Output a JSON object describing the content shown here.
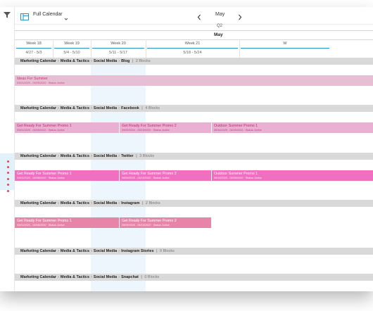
{
  "colors": {
    "accent": "#2b8fc9",
    "header_bg": "#d9d9d9",
    "event_light": "#e7bfd4",
    "event_mid": "#e9b0d3",
    "event_bright": "#ef70c1",
    "event_rose": "#e884a8",
    "status_dot": "#e4455b"
  },
  "toolbar": {
    "filter_icon": "filter-icon",
    "view_icon": "calendar-view-icon",
    "view_label": "Full Calendar",
    "prev_icon": "chevron-left-icon",
    "next_icon": "chevron-right-icon",
    "month": "May"
  },
  "timeline": {
    "quarter": "Q2",
    "month": "May",
    "weeks": [
      {
        "name": "Week 18",
        "range": "4/27 - 5/3"
      },
      {
        "name": "Week 19",
        "range": "5/4 - 5/10"
      },
      {
        "name": "Week 20",
        "range": "5/11 - 5/17"
      },
      {
        "name": "Week 21",
        "range": "5/18 - 5/24"
      },
      {
        "name": "W",
        "range": ""
      }
    ]
  },
  "breadcrumb_base": [
    "Marketing Calendar",
    "Media & Tactics",
    "Social Media"
  ],
  "sections": [
    {
      "channel": "Blog",
      "count": "2 Blocks",
      "events": [
        {
          "title": "Ideas For Summer",
          "meta": "03/01/2020 - 09/25/2020 · Status: Active",
          "style": "light"
        }
      ]
    },
    {
      "channel": "Facebook",
      "count": "4 Blocks",
      "events": [
        {
          "title": "Get Ready For Summer Promo 1",
          "meta": "03/01/2020 - 05/08/2020 · Status: Active",
          "style": "mid"
        },
        {
          "title": "Get Ready For Summer Promo 2",
          "meta": "05/09/2020 - 05/15/2020 · Status: Active",
          "style": "mid"
        },
        {
          "title": "Outdoor Summer Promo 1",
          "meta": "05/16/2020 - 06/30/2020 · Status: Active",
          "style": "mid"
        }
      ]
    },
    {
      "channel": "Twitter",
      "count": "3 Blocks",
      "events": [
        {
          "title": "Get Ready For Summer Promo 1",
          "meta": "03/01/2020 - 05/08/2020 · Status: Active",
          "style": "bright"
        },
        {
          "title": "Get Ready For Summer Promo 2",
          "meta": "05/09/2020 - 05/15/2020 · Status: Active",
          "style": "bright"
        },
        {
          "title": "Outdoor Summer Promo 1",
          "meta": "05/16/2020 - 06/30/2020 · Status: Active",
          "style": "bright"
        }
      ]
    },
    {
      "channel": "Instagram",
      "count": "2 Blocks",
      "events": [
        {
          "title": "Get Ready For Summer Promo 1",
          "meta": "03/01/2020 - 05/08/2020 · Status: Active",
          "style": "rose"
        },
        {
          "title": "Get Ready For Summer Promo 2",
          "meta": "05/09/2020 - 05/15/2020 · Status: Active",
          "style": "rose"
        }
      ]
    },
    {
      "channel": "Instagram Stories",
      "count": "0 Blocks",
      "events": []
    },
    {
      "channel": "Snapchat",
      "count": "0 Blocks",
      "events": []
    }
  ]
}
